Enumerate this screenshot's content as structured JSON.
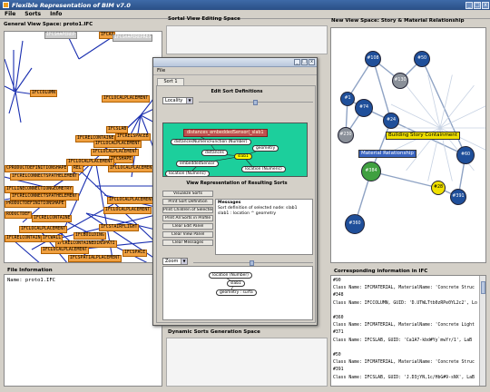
{
  "window": {
    "title": "Flexible Representation of BIM v7.0",
    "buttons": [
      "_",
      "□",
      "x"
    ]
  },
  "menubar": [
    "File",
    "Sorts",
    "Info"
  ],
  "panels": {
    "general_view": "General View Space: proto1.IFC",
    "sortal_view": "Sortal View Editing Space",
    "new_view": "New View Space: Story & Material Relationship",
    "file_info": "File Information",
    "dynamic_sorts": "Dynamic Sorts Generation Space",
    "corresponding": "Corresponding information in IFC"
  },
  "file_info": {
    "name_label": "Name:",
    "name_value": "proto1.IFC"
  },
  "general_nodes": [
    "IFCSHAPEREP",
    "IFCAX",
    "IFCSHAPEREPRES",
    "IFCCOLUMN",
    "IFCLOCALPLACEMENT",
    "IFCSLAB",
    "IFCRELCONTAINE",
    "IFCRELSPACEB",
    "IFCLOCALPLACEMENT",
    "IFCLOCALPLACEMENT",
    "IFCSHAPE",
    "IFCLOCALPLACEMENT",
    "CPRODUCTDEFINITIONSHAPE",
    "REL",
    "IFCRELCONNECTSPATHELEMENT",
    "IFCLOCALPLACEMENT",
    "IFCLINECONNECTIONGEOMETRY",
    "IFCRELCONNECTSPATHELEMENT",
    "PRODUCTDEFINITIONSHAPE",
    "IFCLOCALPLACEMENT",
    "IFCLOCALPLACEMENT",
    "RODUCTDEF",
    "IFCRELCONTAINE",
    "IFCSTAIRFLIGHT",
    "IFCLOCALPLACEMENT",
    "IFCRELCONTAINE",
    "IFCBUILDING",
    "IFCRELCONTAINEDINSPATI",
    "IFCLOCALPLACEMENT",
    "IFCSPATIALPLACEMENT",
    "IFCWALL",
    "IFCSPACE"
  ],
  "float": {
    "menu": "File",
    "tab": "Sort 1",
    "edit_title": "Edit Sort Definitions",
    "locality": "Locality",
    "view_title": "View Representation of Resulting Sorts",
    "zoom": "Zoom",
    "def_nodes": {
      "banner": "distances_embeddedSensor(_slab1",
      "n1": "distancesNumericFunction (Number)",
      "n2": "distances",
      "n3": "geometry",
      "n4": "slab1",
      "n5": "embeddedSensor",
      "n6": "location (Numeric)",
      "n7": "location (Numeric)"
    },
    "buttons": [
      "Visualize Sorts",
      "Print Sort Definition",
      "Print Children of Selected",
      "Print All Sorts in Profile",
      "Clear Edit Panel",
      "Clear View Panel",
      "Clear Messages"
    ],
    "messages_title": "Messages",
    "messages": [
      "Sort definition of selected node: slab1",
      "slab1 : location ^ geometry"
    ],
    "zoom_nodes": {
      "a": "location (Number)",
      "b": "slab1",
      "c": "geometry : surfa"
    }
  },
  "network": {
    "nodes": [
      "#108",
      "#130",
      "#50",
      "#1",
      "#74",
      "#230",
      "#24",
      "#60",
      "#28",
      "#391",
      "#384",
      "#360"
    ],
    "labels": {
      "story": "Building Story Containment",
      "material": "Material Relationship"
    },
    "colors": {
      "blue": "#1f4f9a",
      "green": "#40a040",
      "grey": "#8a9099",
      "yellow": "#f0e000",
      "edge": "#8fa3c4"
    }
  },
  "ifc_lines": [
    "#90",
    "Class Name: IFCMATERIAL, MaterialName: 'Concrete Struc",
    "#348",
    "Class Name: IFCCOLUMN, GUID: 'D.UTWLTtb0zRPe0YL2c2', Lo",
    "",
    "#360",
    "Class Name: IFCMATERIAL, MaterialName: 'Concrete Light",
    "#371",
    "Class Name: IFCSLAB, GUID: 'Ca1A7-kbd#Yy`mwYr/1', LaB",
    "",
    "#50",
    "Class Name: IFCMATERIAL, MaterialName: 'Concrete Struc",
    "#391",
    "Class Name: IFCSLAB, GUID: 'J.D3jYN,1c/HbG#9-sNX', LaB"
  ]
}
